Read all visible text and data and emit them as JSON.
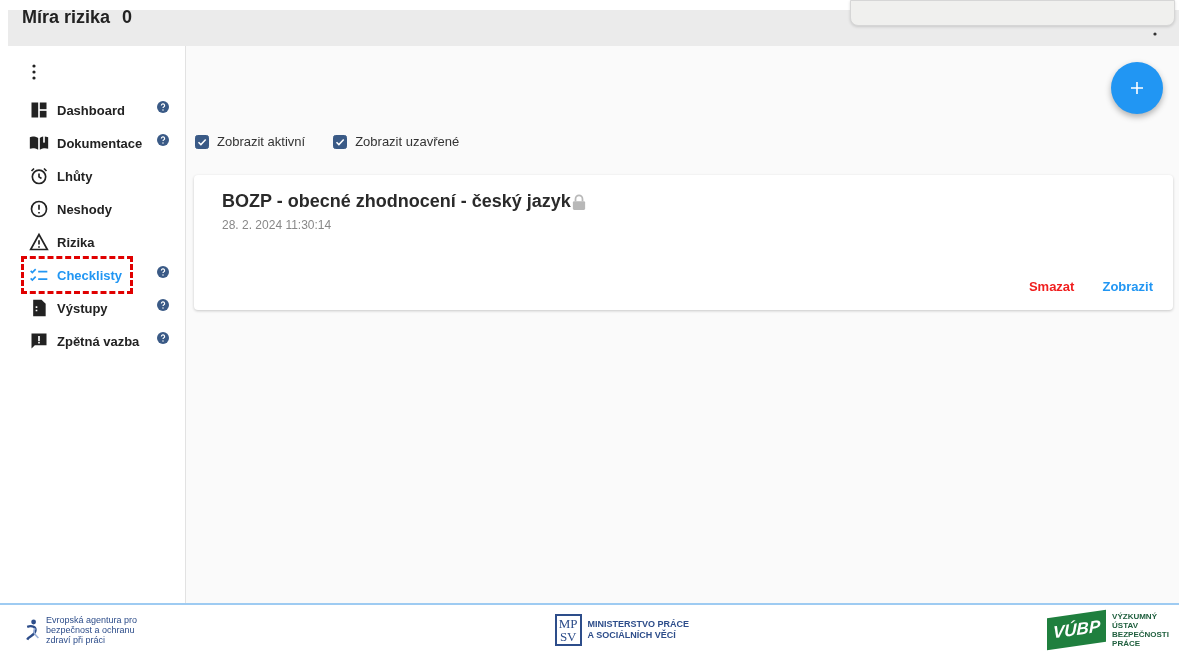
{
  "header": {
    "title": "Míra rizika",
    "value": "0"
  },
  "sidebar": {
    "items": [
      {
        "label": "Dashboard",
        "help": true,
        "selected": false,
        "highlighted": false
      },
      {
        "label": "Dokumentace",
        "help": true,
        "selected": false,
        "highlighted": false
      },
      {
        "label": "Lhůty",
        "help": false,
        "selected": false,
        "highlighted": false
      },
      {
        "label": "Neshody",
        "help": false,
        "selected": false,
        "highlighted": false
      },
      {
        "label": "Rizika",
        "help": false,
        "selected": false,
        "highlighted": false
      },
      {
        "label": "Checklisty",
        "help": true,
        "selected": true,
        "highlighted": true
      },
      {
        "label": "Výstupy",
        "help": true,
        "selected": false,
        "highlighted": false
      },
      {
        "label": "Zpětná vazba",
        "help": true,
        "selected": false,
        "highlighted": false
      }
    ]
  },
  "filters": [
    {
      "label": "Zobrazit aktivní",
      "checked": true
    },
    {
      "label": "Zobrazit uzavřené",
      "checked": true
    }
  ],
  "checklists": [
    {
      "title": "BOZP - obecné zhodnocení - český jazyk",
      "locked": true,
      "date": "28. 2. 2024 11:30:14",
      "actions": [
        {
          "label": "Smazat",
          "kind": "danger"
        },
        {
          "label": "Zobrazit",
          "kind": "primary"
        }
      ]
    }
  ],
  "footer": {
    "eu_osha": [
      "Evropská agentura pro",
      "bezpečnost a ochranu",
      "zdraví při práci"
    ],
    "mpsv_mark": [
      "MP",
      "SV"
    ],
    "mpsv": [
      "MINISTERSTVO PRÁCE",
      "A SOCIÁLNÍCH VĚCÍ"
    ],
    "vubp_mark": "VÚBP",
    "vubp": [
      "VÝZKUMNÝ",
      "ÚSTAV",
      "BEZPEČNOSTI",
      "PRÁCE"
    ]
  }
}
